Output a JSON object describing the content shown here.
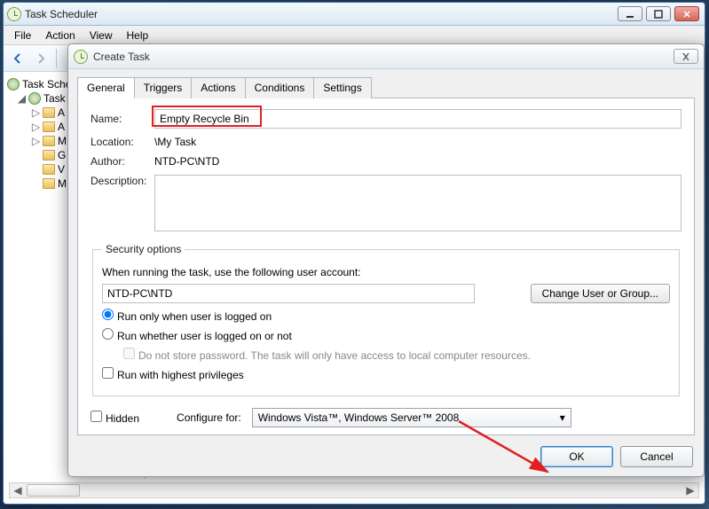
{
  "main_window": {
    "title": "Task Scheduler",
    "menubar": {
      "file": "File",
      "action": "Action",
      "view": "View",
      "help": "Help"
    }
  },
  "tree": {
    "root": "Task Scheduler",
    "lib": "Task",
    "items": [
      "A",
      "A",
      "M",
      "G",
      "V",
      "M"
    ]
  },
  "dialog": {
    "title": "Create Task",
    "tabs": {
      "general": "General",
      "triggers": "Triggers",
      "actions": "Actions",
      "conditions": "Conditions",
      "settings": "Settings"
    },
    "labels": {
      "name": "Name:",
      "location": "Location:",
      "author": "Author:",
      "description": "Description:"
    },
    "name_value": "Empty Recycle Bin",
    "location_value": "\\My Task",
    "author_value": "NTD-PC\\NTD",
    "description_value": "",
    "security": {
      "legend": "Security options",
      "when_running": "When running the task, use the following user account:",
      "account": "NTD-PC\\NTD",
      "change_btn": "Change User or Group...",
      "opt_logged_on": "Run only when user is logged on",
      "opt_whether": "Run whether user is logged on or not",
      "opt_nostore": "Do not store password.  The task will only have access to local computer resources.",
      "opt_highest": "Run with highest privileges"
    },
    "hidden_label": "Hidden",
    "configure_label": "Configure for:",
    "configure_value": "Windows Vista™, Windows Server™ 2008",
    "ok": "OK",
    "cancel": "Cancel"
  }
}
